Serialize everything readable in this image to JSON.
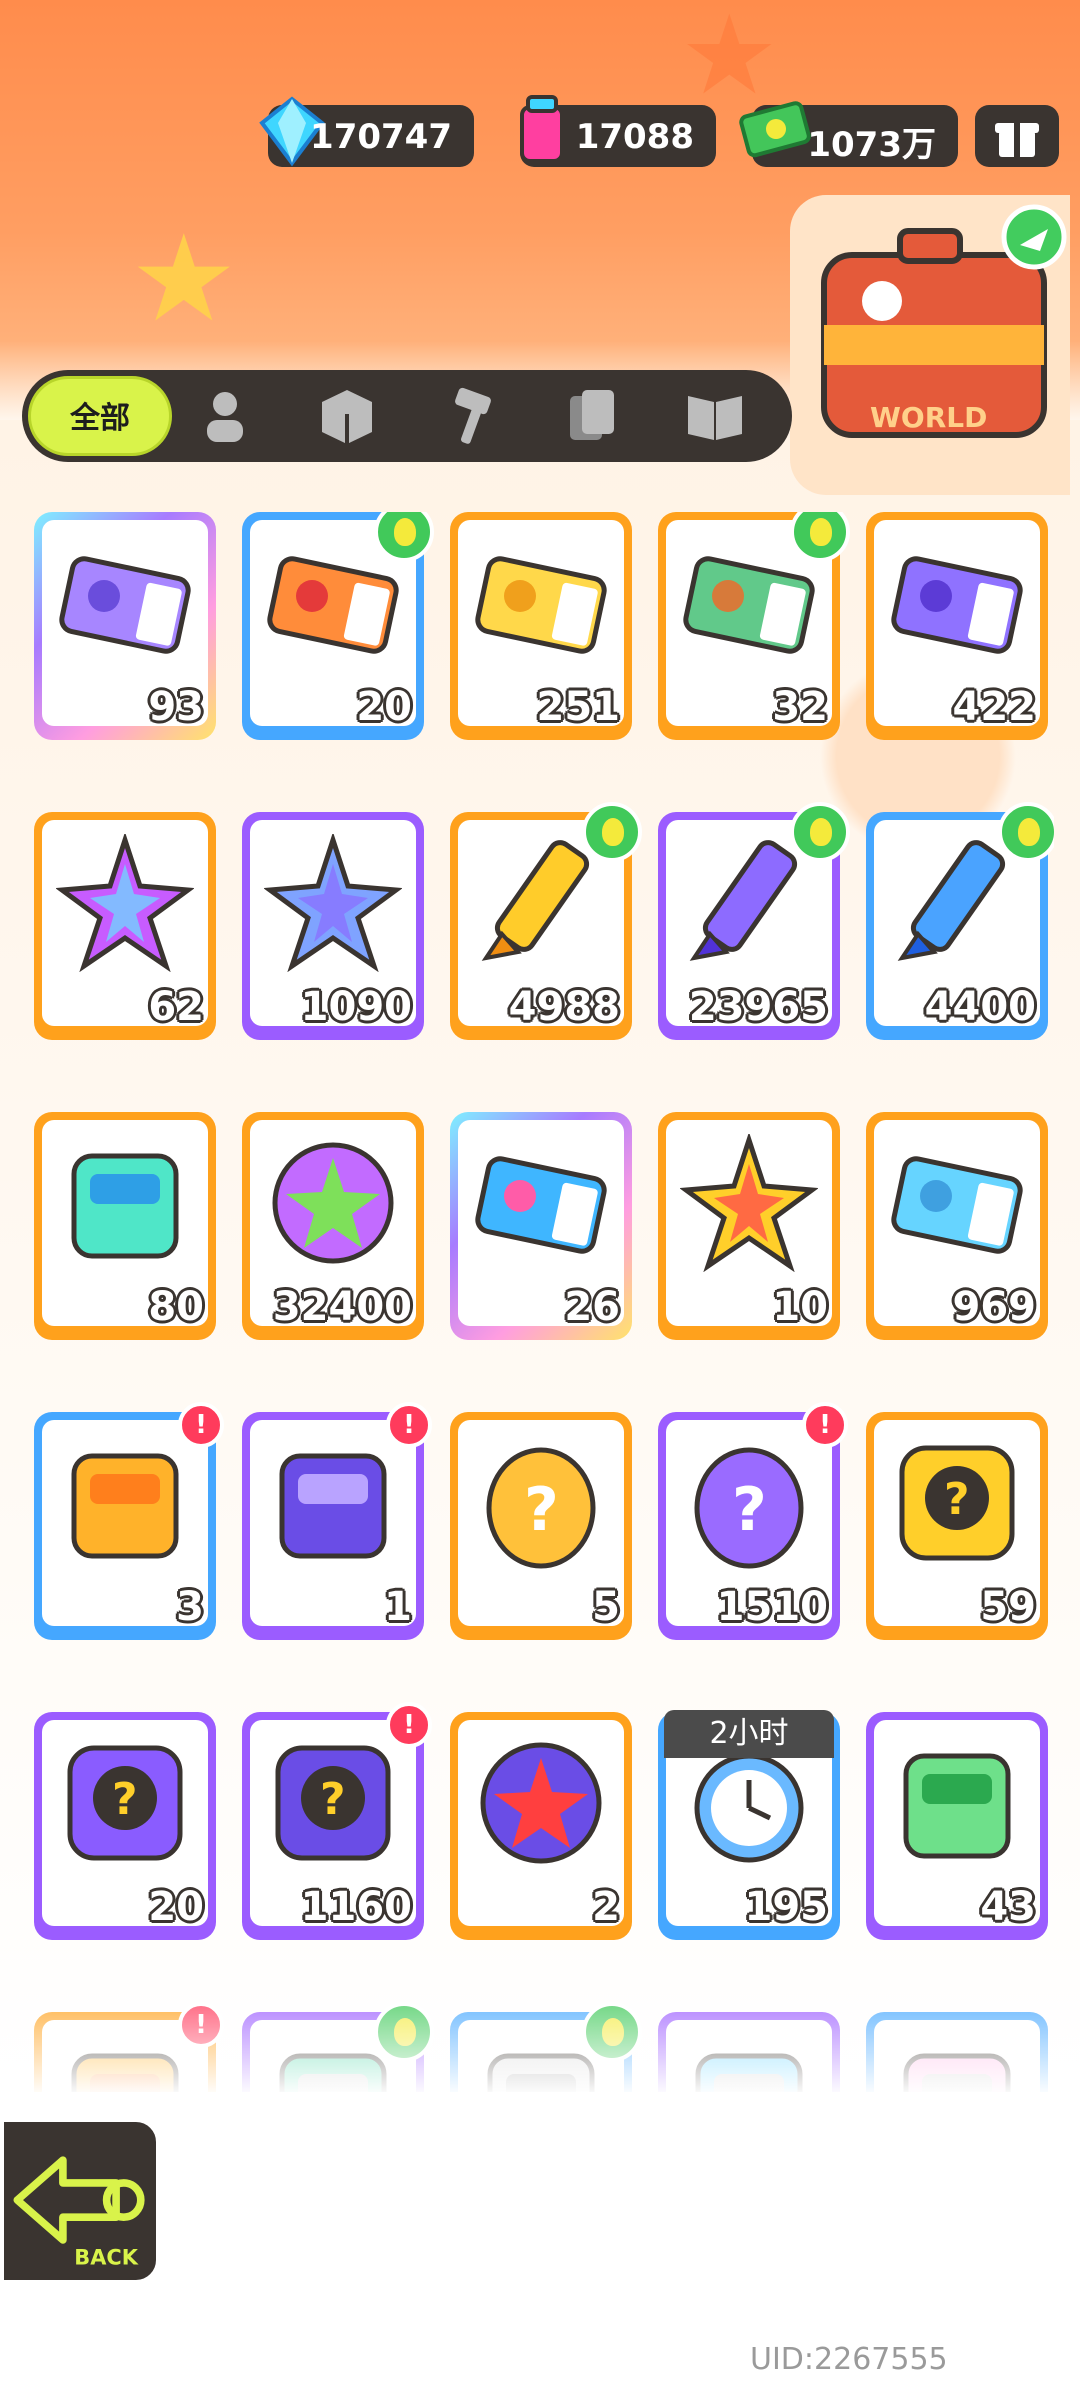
{
  "currencies": [
    {
      "icon": "diamond-icon",
      "value": "170747"
    },
    {
      "icon": "paint-can-icon",
      "value": "17088"
    },
    {
      "icon": "cash-icon",
      "value": "1073万"
    }
  ],
  "world_card": {
    "label": "WORLD"
  },
  "tabs": [
    {
      "label": "全部",
      "icon": "all"
    },
    {
      "label": "",
      "icon": "person-icon"
    },
    {
      "label": "",
      "icon": "box-icon"
    },
    {
      "label": "",
      "icon": "hammer-icon"
    },
    {
      "label": "",
      "icon": "cards-icon"
    },
    {
      "label": "",
      "icon": "book-icon"
    }
  ],
  "items": [
    {
      "count": "93",
      "frame": "rainbow",
      "art": "ticket-purple",
      "badge": ""
    },
    {
      "count": "20",
      "frame": "blue",
      "art": "ticket-lion",
      "badge": "green"
    },
    {
      "count": "251",
      "frame": "orange",
      "art": "ticket-gold",
      "badge": ""
    },
    {
      "count": "32",
      "frame": "orange",
      "art": "ticket-bread",
      "badge": "green"
    },
    {
      "count": "422",
      "frame": "orange",
      "art": "ticket-violet",
      "badge": ""
    },
    {
      "count": "62",
      "frame": "orange",
      "art": "star-rainbow",
      "badge": ""
    },
    {
      "count": "1090",
      "frame": "purple",
      "art": "star-blue",
      "badge": ""
    },
    {
      "count": "4988",
      "frame": "orange",
      "art": "crayon-yellow",
      "badge": "green"
    },
    {
      "count": "23965",
      "frame": "purple",
      "art": "crayon-purple",
      "badge": "green"
    },
    {
      "count": "4400",
      "frame": "blue",
      "art": "crayon-blue",
      "badge": "green"
    },
    {
      "count": "80",
      "frame": "orange",
      "art": "color-cube",
      "badge": ""
    },
    {
      "count": "32400",
      "frame": "orange",
      "art": "cool-coin",
      "badge": ""
    },
    {
      "count": "26",
      "frame": "rainbow",
      "art": "lottery-ticket",
      "badge": ""
    },
    {
      "count": "10",
      "frame": "orange",
      "art": "star-badge",
      "badge": ""
    },
    {
      "count": "969",
      "frame": "orange",
      "art": "season-ticket",
      "badge": ""
    },
    {
      "count": "3",
      "frame": "blue",
      "art": "cool-box",
      "badge": "red"
    },
    {
      "count": "1",
      "frame": "purple",
      "art": "travel-card",
      "badge": "red"
    },
    {
      "count": "5",
      "frame": "orange",
      "art": "egg-orange",
      "badge": ""
    },
    {
      "count": "1510",
      "frame": "purple",
      "art": "egg-purple",
      "badge": "red"
    },
    {
      "count": "59",
      "frame": "orange",
      "art": "deity-gold",
      "badge": ""
    },
    {
      "count": "20",
      "frame": "purple",
      "art": "deity-purple",
      "badge": ""
    },
    {
      "count": "1160",
      "frame": "purple",
      "art": "travel-mystery",
      "badge": "red"
    },
    {
      "count": "2",
      "frame": "orange",
      "art": "pet-fish",
      "badge": ""
    },
    {
      "count": "195",
      "frame": "blue",
      "art": "alarm-clock",
      "badge": "",
      "timer": "2小时"
    },
    {
      "count": "43",
      "frame": "purple",
      "art": "open-cup",
      "badge": ""
    },
    {
      "count": "",
      "frame": "orange",
      "art": "cool-box",
      "badge": "red"
    },
    {
      "count": "",
      "frame": "purple",
      "art": "spray-green",
      "badge": "green"
    },
    {
      "count": "",
      "frame": "blue",
      "art": "can-silver",
      "badge": "green"
    },
    {
      "count": "",
      "frame": "purple",
      "art": "spray-blue",
      "badge": ""
    },
    {
      "count": "",
      "frame": "blue",
      "art": "can-pink",
      "badge": ""
    }
  ],
  "back_button": {
    "label": "BACK"
  },
  "uid": "UID:2267555",
  "colors": {
    "orange": "#ffa11c",
    "purple": "#9b5cff",
    "blue": "#45a7ff",
    "accent": "#d9f34a",
    "dark": "#3a3430"
  }
}
